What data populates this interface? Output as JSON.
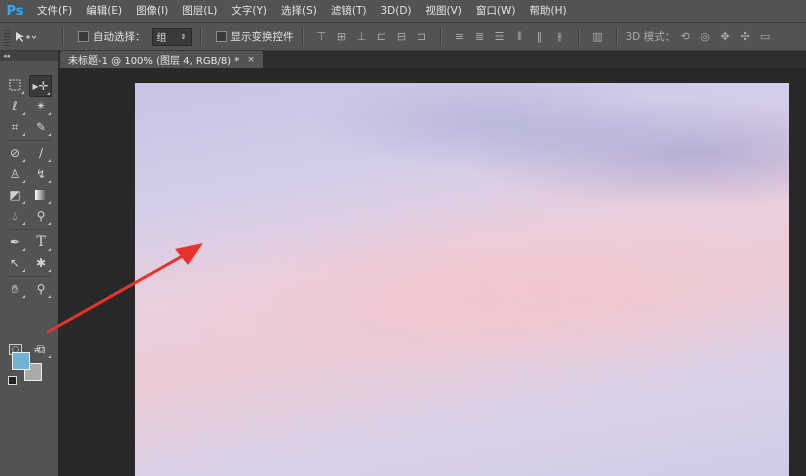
{
  "app": {
    "logo": "Ps"
  },
  "menu": [
    "文件(F)",
    "编辑(E)",
    "图像(I)",
    "图层(L)",
    "文字(Y)",
    "选择(S)",
    "滤镜(T)",
    "3D(D)",
    "视图(V)",
    "窗口(W)",
    "帮助(H)"
  ],
  "options": {
    "auto_select_label": "自动选择：",
    "auto_select_value": "组",
    "show_transform_label": "显示变换控件",
    "mode_3d_label": "3D 模式："
  },
  "document": {
    "tab_title": "未标题-1 @ 100% (图层 4, RGB/8) *",
    "close": "×"
  },
  "toolbox": {
    "collapse": "◂◂"
  },
  "colors": {
    "foreground": "#6fb2d5",
    "background": "#aaaaaa",
    "annotation_arrow": "#e8332a"
  }
}
